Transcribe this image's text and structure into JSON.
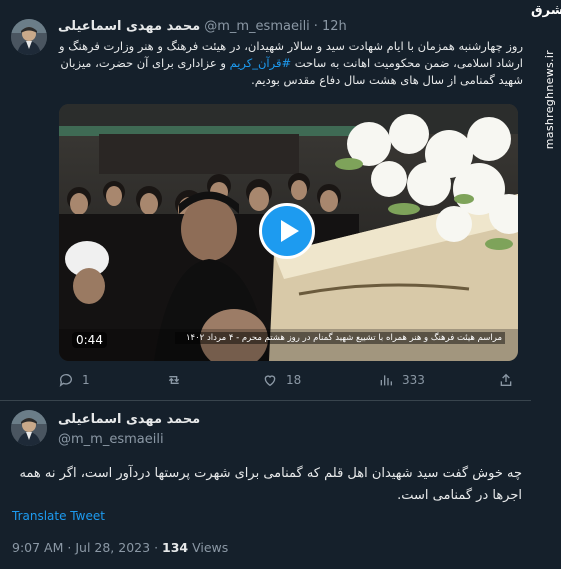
{
  "watermark": {
    "logo": "مشرق",
    "url": "mashreghnews.ir"
  },
  "quoted_tweet": {
    "author_name": "محمد مهدی اسماعیلی",
    "handle": "@m_m_esmaeili",
    "separator": "·",
    "time": "12h",
    "text_before_hashtag": "روز چهارشنبه همزمان با ایام شهادت سید و سالار شهیدان، در هیئت فرهنگ و هنر وزارت فرهنگ و ارشاد اسلامی، ضمن محکومیت اهانت به ساحت ",
    "hashtag": "#قرآن_کریم",
    "text_after_hashtag": " و عزاداری برای آن حضرت، میزبان شهید گمنامی از سال های هشت سال دفاع مقدس بودیم.",
    "video": {
      "duration": "0:44",
      "caption": "مراسم هیئت فرهنگ و هنر همراه با تشییع شهید گمنام در روز هشتم محرم - ۴ مرداد ۱۴۰۲"
    },
    "actions": {
      "reply_count": "1",
      "retweet_count": "",
      "like_count": "18",
      "views_count": "333"
    }
  },
  "main_tweet": {
    "author_name": "محمد مهدی اسماعیلی",
    "handle": "@m_m_esmaeili",
    "text": "چه خوش گفت سید شهیدان اهل قلم که گمنامی برای شهرت پرستها دردآور است، اگر نه همه اجرها در گمنامی است.",
    "translate_label": "Translate Tweet",
    "time": "9:07 AM",
    "date": "Jul 28, 2023",
    "views_count": "134",
    "views_label": "Views",
    "separator": "·"
  },
  "colors": {
    "background": "#15202b",
    "accent": "#1d9bf0",
    "muted": "#8b98a5",
    "divider": "#38444d"
  },
  "icons": [
    "reply-icon",
    "retweet-icon",
    "like-icon",
    "views-icon",
    "share-icon",
    "play-icon"
  ]
}
